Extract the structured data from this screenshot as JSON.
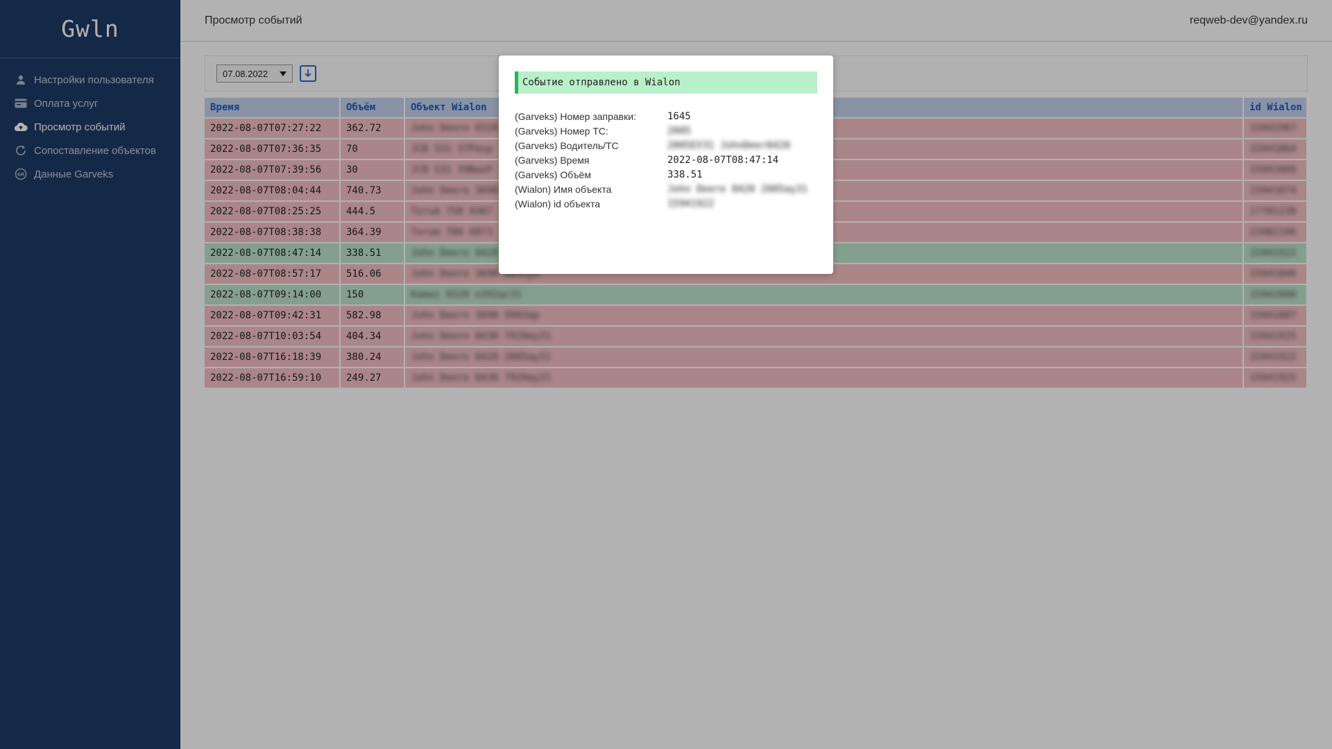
{
  "app": {
    "logo": "Gwln"
  },
  "sidebar": {
    "items": [
      {
        "label": "Настройки пользователя",
        "icon": "user-icon"
      },
      {
        "label": "Оплата услуг",
        "icon": "credit-card-icon"
      },
      {
        "label": "Просмотр событий",
        "icon": "cloud-upload-icon",
        "active": true
      },
      {
        "label": "Сопоставление объектов",
        "icon": "refresh-icon"
      },
      {
        "label": "Данные Garveks",
        "icon": "gr-badge-icon"
      }
    ]
  },
  "header": {
    "title": "Просмотр событий",
    "user": "reqweb-dev@yandex.ru"
  },
  "toolbar": {
    "date": "07.08.2022"
  },
  "table": {
    "headers": [
      "Время",
      "Объём",
      "Объект Wialon",
      "id Wialon"
    ],
    "rows": [
      {
        "time": "2022-08-07T07:27:22",
        "volume": "362.72",
        "object": "John Deere 8320 2005",
        "id": "15941907",
        "status": "red"
      },
      {
        "time": "2022-08-07T07:36:35",
        "volume": "70",
        "object": "JCB 531 Э7Pasp",
        "id": "15941864",
        "status": "red"
      },
      {
        "time": "2022-08-07T07:39:56",
        "volume": "30",
        "object": "JCB 531 Э9ВasP",
        "id": "15941869",
        "status": "red"
      },
      {
        "time": "2022-08-07T08:04:44",
        "volume": "740.73",
        "object": "John Deere 3690",
        "id": "15941874",
        "status": "red"
      },
      {
        "time": "2022-08-07T08:25:25",
        "volume": "444.5",
        "object": "Torum 750 9387",
        "id": "17781230",
        "status": "red"
      },
      {
        "time": "2022-08-07T08:38:38",
        "volume": "364.39",
        "object": "Torum 780 6873",
        "id": "23982196",
        "status": "red"
      },
      {
        "time": "2022-08-07T08:47:14",
        "volume": "338.51",
        "object": "John Deere 8420",
        "id": "15941922",
        "status": "green"
      },
      {
        "time": "2022-08-07T08:57:17",
        "volume": "516.06",
        "object": "John Deere 3690 Бвоxyd",
        "id": "15941846",
        "status": "red"
      },
      {
        "time": "2022-08-07T09:14:00",
        "volume": "150",
        "object": "Kamaz 6520 о392ас31",
        "id": "15942000",
        "status": "green"
      },
      {
        "time": "2022-08-07T09:42:31",
        "volume": "582.98",
        "object": "John Deere 3690 5003ap",
        "id": "15941887",
        "status": "red"
      },
      {
        "time": "2022-08-07T10:03:54",
        "volume": "404.34",
        "object": "John Deere 8430 7920ay31",
        "id": "15941925",
        "status": "red"
      },
      {
        "time": "2022-08-07T16:18:39",
        "volume": "380.24",
        "object": "John Deere 8420 2005ay31",
        "id": "15941922",
        "status": "red"
      },
      {
        "time": "2022-08-07T16:59:10",
        "volume": "249.27",
        "object": "John Deere 8430 7920ay31",
        "id": "15941925",
        "status": "red"
      }
    ]
  },
  "modal": {
    "banner": "Событие отправлено в Wialon",
    "fields": [
      {
        "label": "(Garveks) Номер заправки:",
        "value": "1645",
        "blurred": false
      },
      {
        "label": "(Garveks) Номер ТС:",
        "value": "2005",
        "blurred": true
      },
      {
        "label": "(Garveks) Водитель/ТС",
        "value": "2005ЕУ31 JohnDeer8420",
        "blurred": true
      },
      {
        "label": "(Garveks) Время",
        "value": "2022-08-07T08:47:14",
        "blurred": false
      },
      {
        "label": "(Garveks) Объём",
        "value": "338.51",
        "blurred": false
      },
      {
        "label": "(Wialon) Имя объекта",
        "value": "John Deere 8420 2005ay31",
        "blurred": true
      },
      {
        "label": "(Wialon) id объекта",
        "value": "15941922",
        "blurred": true
      }
    ]
  },
  "colors": {
    "sidebar": "#1e3a66",
    "row_red": "#f5c0c3",
    "row_green": "#bfe4cc",
    "header_row": "#c5d3ec",
    "accent": "#2f66c8",
    "banner": "#b9f0c9",
    "banner_border": "#2ab45a"
  }
}
